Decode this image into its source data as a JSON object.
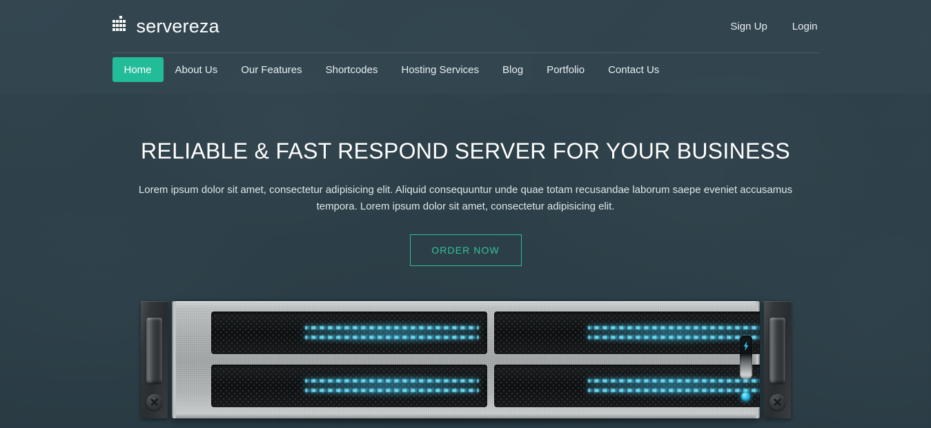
{
  "brand": {
    "name": "servereza",
    "logo_icon": "grid-squares-logo-icon"
  },
  "header": {
    "auth_links": [
      {
        "label": "Sign Up",
        "name": "sign-up-link"
      },
      {
        "label": "Login",
        "name": "login-link"
      }
    ],
    "nav_items": [
      {
        "label": "Home",
        "active": true
      },
      {
        "label": "About Us",
        "active": false
      },
      {
        "label": "Our Features",
        "active": false
      },
      {
        "label": "Shortcodes",
        "active": false
      },
      {
        "label": "Hosting Services",
        "active": false
      },
      {
        "label": "Blog",
        "active": false
      },
      {
        "label": "Portfolio",
        "active": false
      },
      {
        "label": "Contact Us",
        "active": false
      }
    ]
  },
  "hero": {
    "title": "RELIABLE & FAST RESPOND SERVER FOR YOUR BUSINESS",
    "subtitle": "Lorem ipsum dolor sit amet, consectetur adipisicing elit. Aliquid consequuntur unde quae totam recusandae laborum saepe eveniet accusamus tempora. Lorem ipsum dolor sit amet, consectetur adipisicing elit.",
    "cta_label": "ORDER NOW"
  },
  "server_graphic": {
    "alt": "Rack mount server illustration with four drive bays",
    "power_button_icon": "lightning-bolt-icon",
    "status_led_name": "status-led-indicator",
    "bays": 4
  },
  "colors": {
    "accent": "#23bc98",
    "cta_border": "#2ec095",
    "cta_text": "#33c49c",
    "header_bg": "#38525e",
    "page_bg": "#2e4049",
    "text_light": "#ffffff",
    "led_cyan": "#35c8f0"
  }
}
